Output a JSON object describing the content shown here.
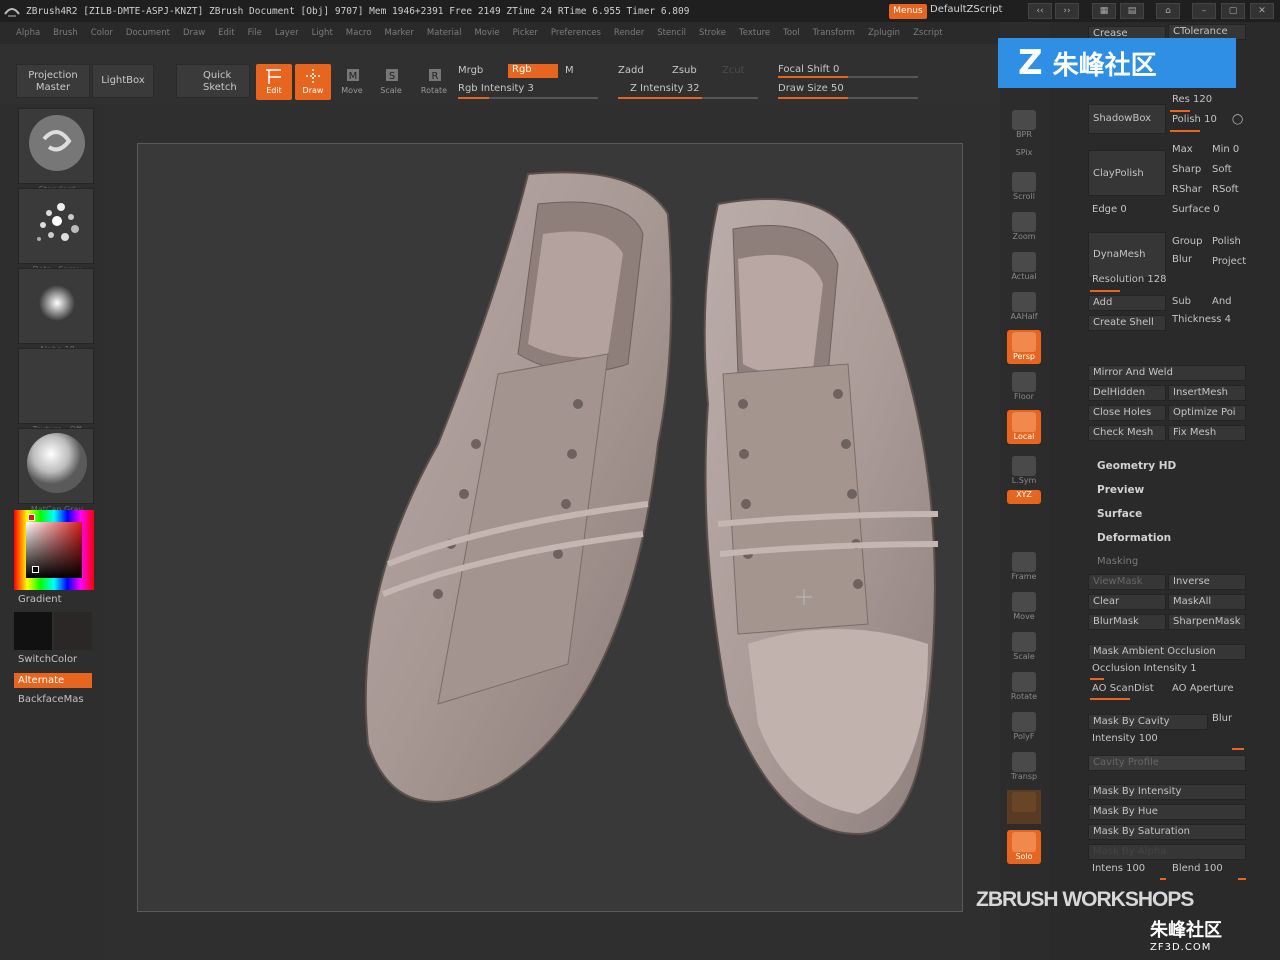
{
  "titlebar": {
    "text": "ZBrush4R2  [ZILB-DMTE-ASPJ-KNZT]      ZBrush Document       [Obj] 9707] Mem 1946+2391  Free 2149  ZTime 24  RTime 6.955  Timer 6.809",
    "menus_label": "Menus",
    "zscript_label": "DefaultZScript"
  },
  "menubar": [
    "Alpha",
    "Brush",
    "Color",
    "Document",
    "Draw",
    "Edit",
    "File",
    "Layer",
    "Light",
    "Macro",
    "Marker",
    "Material",
    "Movie",
    "Picker",
    "Preferences",
    "Render",
    "Stencil",
    "Stroke",
    "Texture",
    "Tool",
    "Transform",
    "Zplugin",
    "Zscript"
  ],
  "shelf": {
    "projection_master": "Projection Master",
    "lightbox": "LightBox",
    "quick_sketch": "Quick Sketch",
    "tools": [
      {
        "label": "Edit",
        "active": true
      },
      {
        "label": "Draw",
        "active": true
      },
      {
        "label": "Move",
        "active": false
      },
      {
        "label": "Scale",
        "active": false
      },
      {
        "label": "Rotate",
        "active": false
      }
    ],
    "mrgb": "Mrgb",
    "rgb": "Rgb",
    "m": "M",
    "rgb_intensity": "Rgb  Intensity 3",
    "zadd": "Zadd",
    "zsub": "Zsub",
    "zcut": "Zcut",
    "z_intensity": "Z  Intensity 32",
    "focal_shift": "Focal  Shift 0",
    "draw_size": "Draw  Size 50"
  },
  "lefttray": {
    "thumbs": [
      "Standard",
      "Dots · Spray",
      "Alpha 18",
      "Texture · Off",
      "MatCap Gray"
    ],
    "gradient": "Gradient",
    "switchcolor": "SwitchColor",
    "alternate": "Alternate",
    "backface": "BackfaceMas"
  },
  "rightshelf": [
    {
      "label": "BPR",
      "active": false
    },
    {
      "label": "SPix",
      "active": false
    },
    {
      "label": "Scroll",
      "active": false
    },
    {
      "label": "Zoom",
      "active": false
    },
    {
      "label": "Actual",
      "active": false
    },
    {
      "label": "AAHalf",
      "active": false
    },
    {
      "label": "Persp",
      "active": true
    },
    {
      "label": "Floor",
      "active": false
    },
    {
      "label": "Local",
      "active": true
    },
    {
      "label": "L.Sym",
      "active": false
    },
    {
      "label": "XYZ",
      "active": true
    },
    {
      "label": "Frame",
      "active": false
    },
    {
      "label": "Move",
      "active": false
    },
    {
      "label": "Scale",
      "active": false
    },
    {
      "label": "Rotate",
      "active": false
    },
    {
      "label": "PolyF",
      "active": false
    },
    {
      "label": "Transp",
      "active": false
    },
    {
      "label": "Ghost",
      "active": false
    },
    {
      "label": "Solo",
      "active": true
    }
  ],
  "righttray": {
    "crease": "Crease",
    "ctolerance": "CTolerance",
    "shadowbox": "ShadowBox",
    "res": "Res 120",
    "polish": "Polish 10",
    "claypolish": "ClayPolish",
    "max": "Max",
    "min": "Min 0",
    "sharp": "Sharp",
    "soft": "Soft",
    "rshar": "RShar",
    "rsoft": "RSoft",
    "edge": "Edge 0",
    "surface": "Surface 0",
    "dynamesh": "DynaMesh",
    "group": "Group",
    "polish2": "Polish",
    "blur": "Blur",
    "project": "Project",
    "resolution": "Resolution 128",
    "add": "Add",
    "sub": "Sub",
    "and": "And",
    "create_shell": "Create Shell",
    "thickness": "Thickness 4",
    "mirror_weld": "Mirror And Weld",
    "delhidden": "DelHidden",
    "insertmesh": "InsertMesh",
    "close_holes": "Close Holes",
    "optimize": "Optimize Poi",
    "check_mesh": "Check Mesh",
    "fix_mesh": "Fix Mesh",
    "sections": [
      "Geometry HD",
      "Preview",
      "Surface",
      "Deformation"
    ],
    "masking": "Masking",
    "viewmask": "ViewMask",
    "inverse": "Inverse",
    "clear": "Clear",
    "maskall": "MaskAll",
    "blurmask": "BlurMask",
    "sharpenmask": "SharpenMask",
    "mask_ao": "Mask Ambient Occlusion",
    "occlusion_intensity": "Occlusion Intensity 1",
    "ao_scandist": "AO ScanDist",
    "ao_aperture": "AO Aperture",
    "mask_cavity": "Mask By Cavity",
    "blur2": "Blur",
    "intensity": "Intensity 100",
    "cavity_profile": "Cavity Profile",
    "mask_intensity": "Mask By Intensity",
    "mask_hue": "Mask By Hue",
    "mask_saturation": "Mask By Saturation",
    "mask_alpha": "Mask By Alpha",
    "intens": "Intens 100",
    "blend": "Blend 100"
  },
  "watermarks": {
    "box": "朱峰社区",
    "workshops": "ZBRUSH WORKSHOPS",
    "bottom_cn": "朱峰社区",
    "bottom_url": "ZF3D.COM"
  }
}
